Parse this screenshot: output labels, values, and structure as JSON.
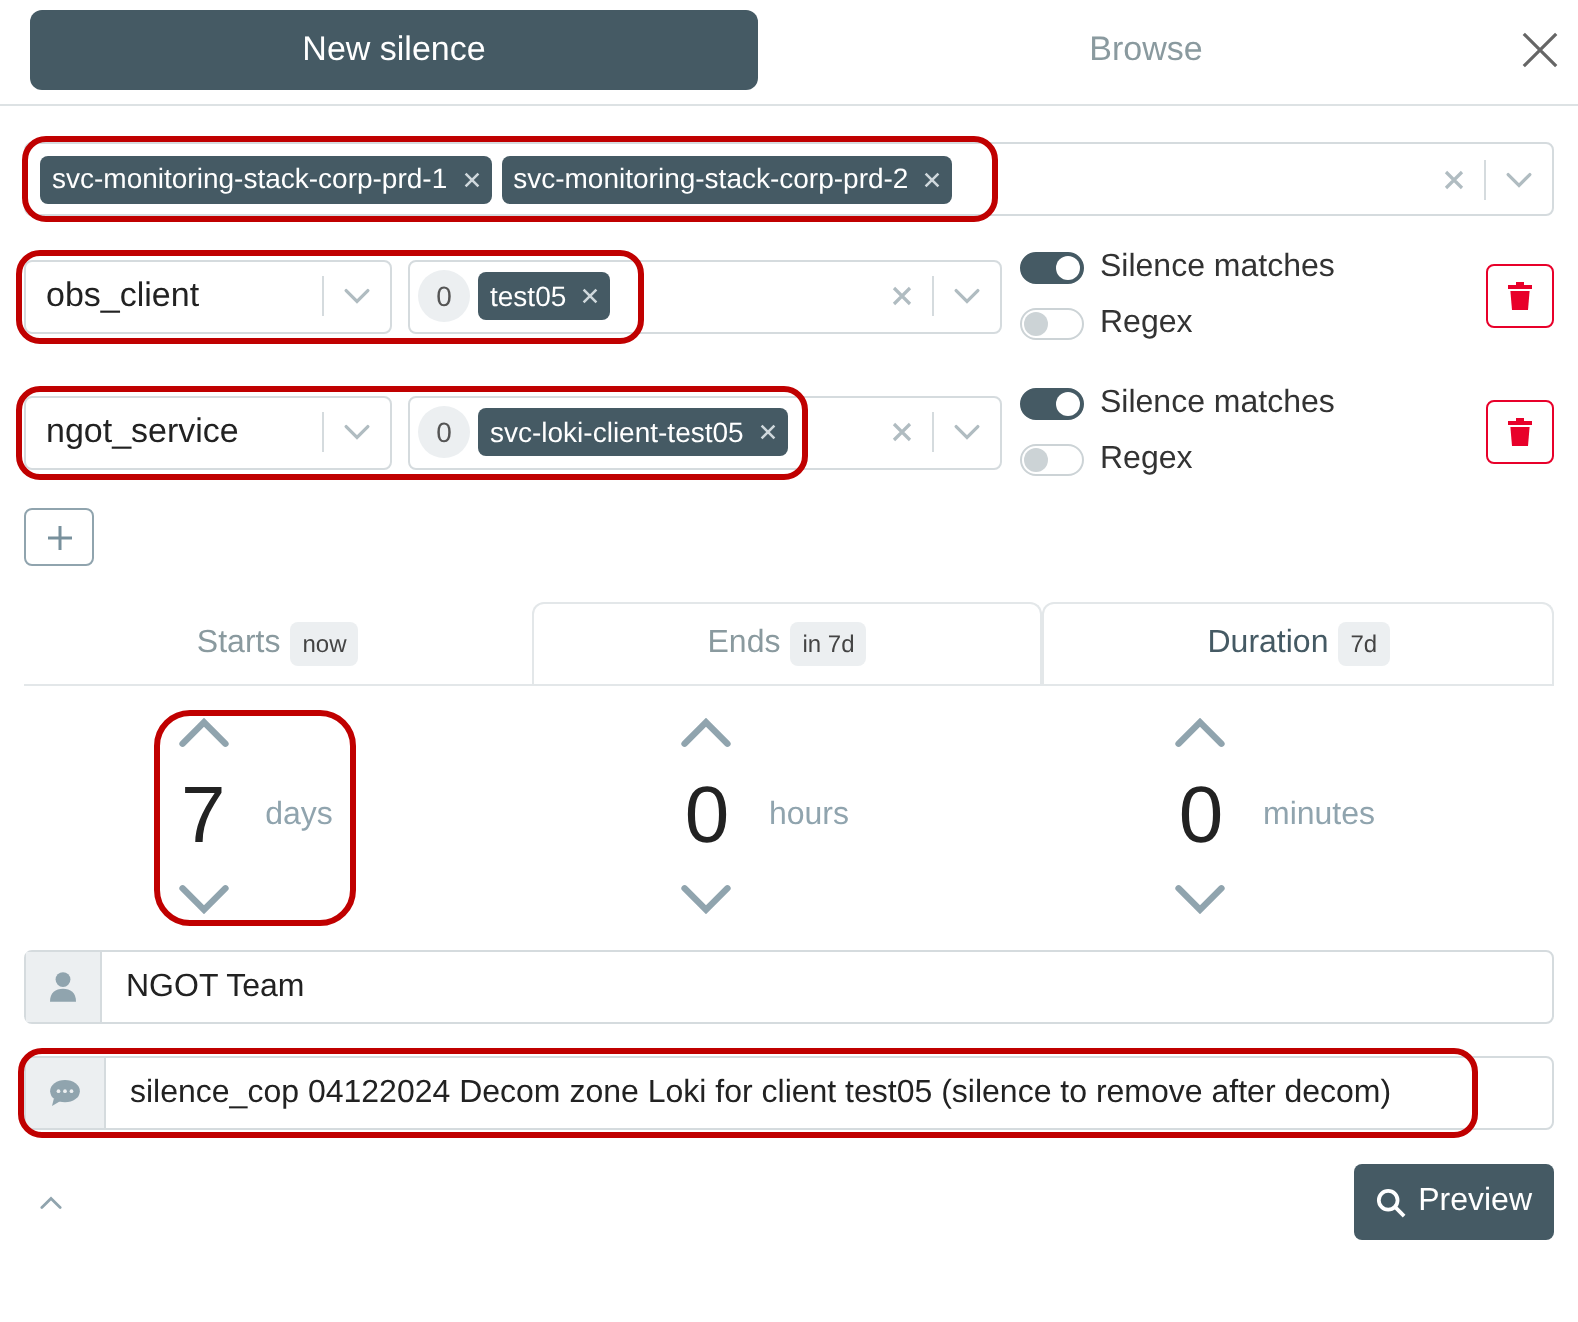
{
  "tabs": [
    {
      "label": "New silence",
      "selected": true
    },
    {
      "label": "Browse",
      "selected": false
    }
  ],
  "cluster_filter": {
    "highlighted": true,
    "values": [
      "svc-monitoring-stack-corp-prd-1",
      "svc-monitoring-stack-corp-prd-2"
    ]
  },
  "matchers": [
    {
      "highlighted": true,
      "name": "obs_client",
      "count": "0",
      "values": [
        "test05"
      ],
      "silence_matches": true,
      "regex": false,
      "silence_label": "Silence matches",
      "regex_label": "Regex"
    },
    {
      "highlighted": true,
      "name": "ngot_service",
      "count": "0",
      "values": [
        "svc-loki-client-test05"
      ],
      "silence_matches": true,
      "regex": false,
      "silence_label": "Silence matches",
      "regex_label": "Regex"
    }
  ],
  "time_tabs": [
    {
      "label": "Starts",
      "badge": "now",
      "selected": false
    },
    {
      "label": "Ends",
      "badge": "in 7d",
      "selected": false
    },
    {
      "label": "Duration",
      "badge": "7d",
      "selected": true
    }
  ],
  "duration": [
    {
      "value": "7",
      "unit": "days",
      "highlighted": true
    },
    {
      "value": "0",
      "unit": "hours",
      "highlighted": false
    },
    {
      "value": "0",
      "unit": "minutes",
      "highlighted": false
    }
  ],
  "author": {
    "value": "NGOT Team"
  },
  "comment": {
    "value": "silence_cop 04122024 Decom zone Loki for client test05 (silence to remove after decom)",
    "highlighted": true
  },
  "preview_button": "Preview"
}
